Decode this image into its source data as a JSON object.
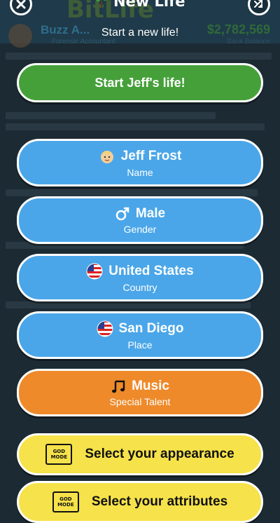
{
  "header": {
    "title": "New Life",
    "subtitle": "Start a new life!",
    "close_icon": "close-icon",
    "shuffle_icon": "shuffle-icon"
  },
  "background": {
    "logo": "BitLife",
    "profile_name": "Buzz A...",
    "profile_sub": "Forensic Accountant",
    "money": "$2,782,569",
    "money_label": "Bank Balance"
  },
  "buttons": {
    "start": "Start Jeff's life!",
    "name": {
      "value": "Jeff Frost",
      "label": "Name",
      "icon": "baby-face-icon"
    },
    "gender": {
      "value": "Male",
      "label": "Gender",
      "icon": "male-symbol-icon"
    },
    "country": {
      "value": "United States",
      "label": "Country",
      "icon": "us-flag-icon"
    },
    "place": {
      "value": "San Diego",
      "label": "Place",
      "icon": "us-flag-icon"
    },
    "talent": {
      "value": "Music",
      "label": "Special Talent",
      "icon": "music-note-icon"
    },
    "appearance": "Select your appearance",
    "attributes": "Select your attributes",
    "god_mode_badge": [
      "GOD",
      "MODE"
    ]
  },
  "colors": {
    "green": "#45a03a",
    "blue": "#4aa6e8",
    "orange": "#ee8a2a",
    "yellow": "#f6e24a"
  }
}
